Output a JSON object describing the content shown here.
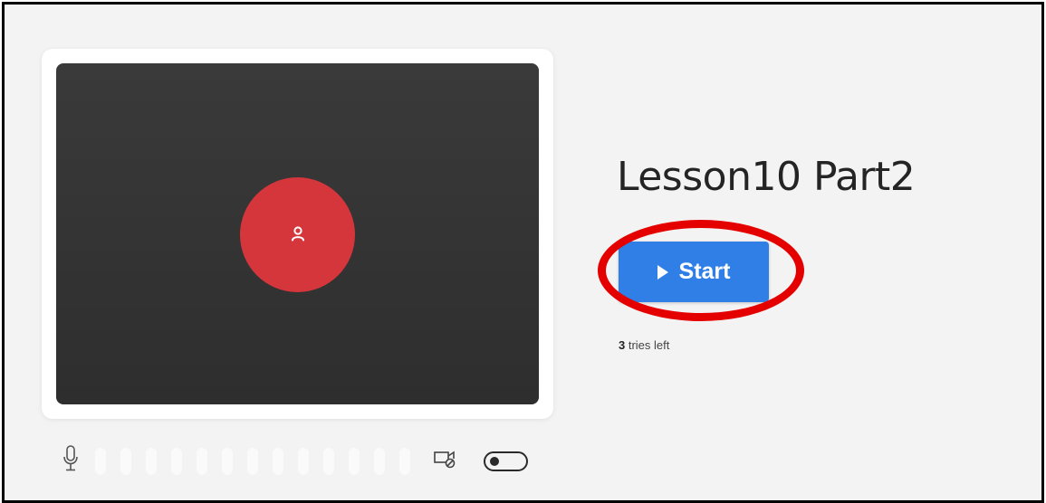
{
  "lesson": {
    "title": "Lesson10 Part2"
  },
  "start_button": {
    "label": "Start",
    "icon": "play-icon",
    "color": "#2f7fe6"
  },
  "attempts": {
    "count": "3",
    "suffix": " tries left"
  },
  "video_preview": {
    "avatar_icon": "user-icon",
    "avatar_color": "#d4363b",
    "background": "#333333"
  },
  "device_controls": {
    "mic_icon": "microphone-icon",
    "camera_icon": "camera-off-icon",
    "camera_toggle_on": false
  },
  "annotation": {
    "highlight_color": "#e50000"
  }
}
